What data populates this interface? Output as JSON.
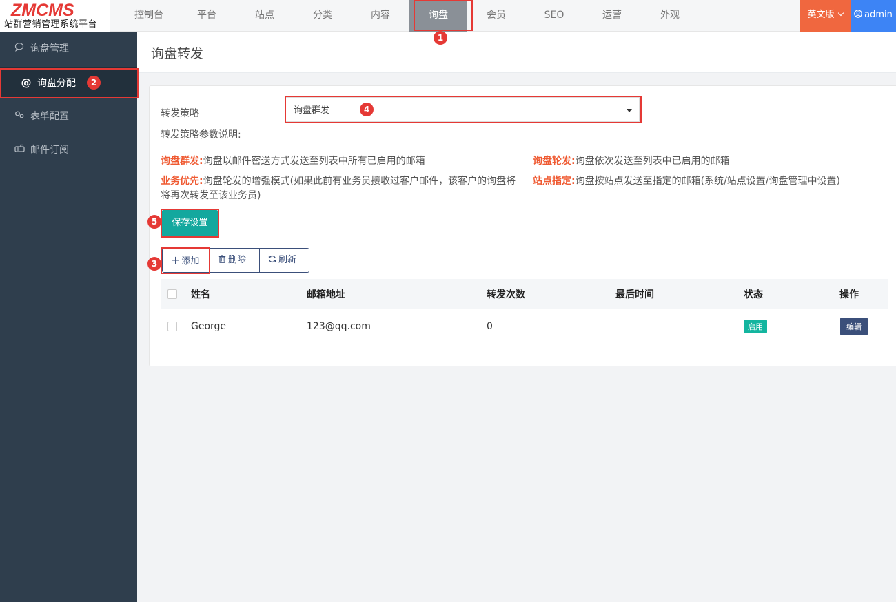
{
  "logo": {
    "main": "ZMCMS",
    "sub": "站群营销管理系统平台"
  },
  "nav": {
    "items": [
      {
        "label": "控制台"
      },
      {
        "label": "平台"
      },
      {
        "label": "站点"
      },
      {
        "label": "分类"
      },
      {
        "label": "内容"
      },
      {
        "label": "询盘"
      },
      {
        "label": "会员"
      },
      {
        "label": "SEO"
      },
      {
        "label": "运营"
      },
      {
        "label": "外观"
      }
    ],
    "active": "询盘",
    "lang_label": "英文版",
    "user_label": "admin"
  },
  "sidebar": {
    "items": [
      {
        "label": "询盘管理",
        "icon": "chat-icon"
      },
      {
        "label": "询盘分配",
        "icon": "at-icon"
      },
      {
        "label": "表单配置",
        "icon": "gears-icon"
      },
      {
        "label": "邮件订阅",
        "icon": "mailbox-icon"
      }
    ],
    "active": "询盘分配"
  },
  "page": {
    "title": "询盘转发"
  },
  "form": {
    "strategy_label": "转发策略",
    "strategy_value": "询盘群发",
    "param_desc_label": "转发策略参数说明:",
    "descriptions": [
      {
        "key": "询盘群发:",
        "text": "询盘以邮件密送方式发送至列表中所有已启用的邮箱"
      },
      {
        "key": "询盘轮发:",
        "text": "询盘依次发送至列表中已启用的邮箱"
      },
      {
        "key": "业务优先:",
        "text": "询盘轮发的增强模式(如果此前有业务员接收过客户邮件，该客户的询盘将将再次转发至该业务员)"
      },
      {
        "key": "站点指定:",
        "text": "询盘按站点发送至指定的邮箱(系统/站点设置/询盘管理中设置)"
      }
    ],
    "save_label": "保存设置"
  },
  "toolbar": {
    "add_label": "添加",
    "delete_label": "删除",
    "refresh_label": "刷新"
  },
  "table": {
    "headers": {
      "name": "姓名",
      "email": "邮箱地址",
      "count": "转发次数",
      "last_time": "最后时间",
      "status": "状态",
      "actions": "操作"
    },
    "rows": [
      {
        "name": "George",
        "email": "123@qq.com",
        "count": "0",
        "last_time": "",
        "status": "启用",
        "action": "编辑"
      }
    ]
  },
  "markers": [
    "1",
    "2",
    "3",
    "4",
    "5"
  ],
  "colors": {
    "accent_red": "#e53935",
    "teal": "#13a89e",
    "navy": "#3b4f7a",
    "orange": "#f0673f",
    "blue": "#3d84f5",
    "sidebar": "#2f3e4d"
  }
}
